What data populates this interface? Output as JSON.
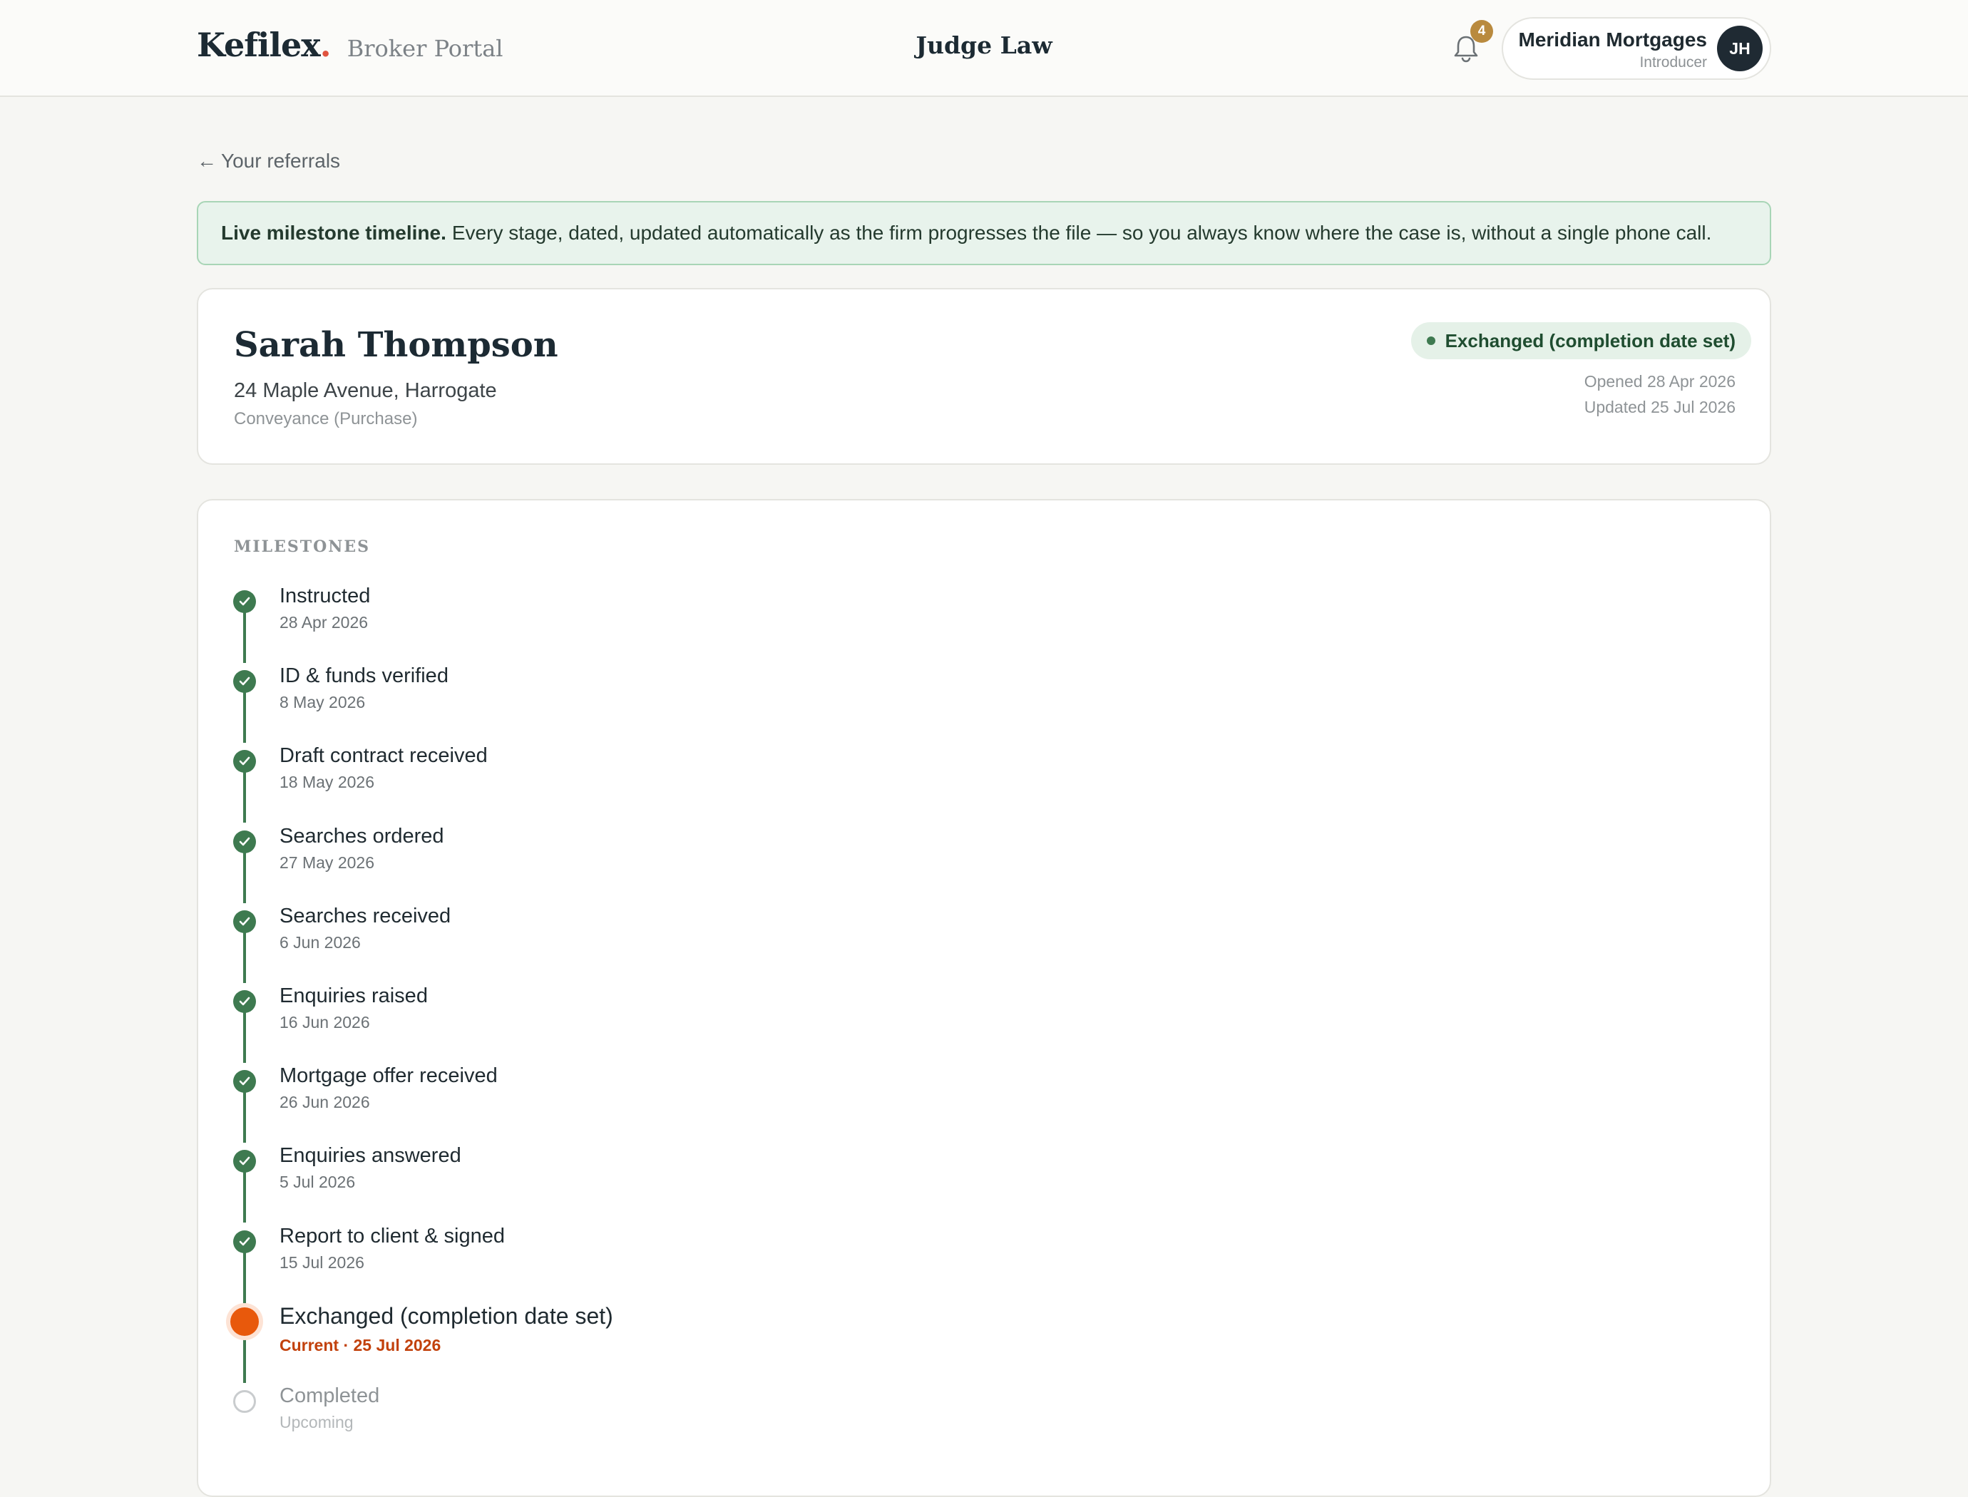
{
  "header": {
    "brand": "Kefilex",
    "brand_dot": ".",
    "portal": "Broker Portal",
    "firm": "Judge Law",
    "notification_count": "4",
    "account_name": "Meridian Mortgages",
    "account_role": "Introducer",
    "avatar_initials": "JH"
  },
  "nav": {
    "back_arrow": "←",
    "back_label": "Your referrals"
  },
  "banner": {
    "bold": "Live milestone timeline.",
    "text": "Every stage, dated, updated automatically as the firm progresses the file — so you always know where the case is, without a single phone call."
  },
  "case": {
    "client_name": "Sarah Thompson",
    "address": "24 Maple Avenue, Harrogate",
    "type": "Conveyance (Purchase)",
    "status": "Exchanged (completion date set)",
    "opened": "Opened 28 Apr 2026",
    "updated": "Updated 25 Jul 2026"
  },
  "milestones": {
    "heading": "MILESTONES",
    "items": [
      {
        "title": "Instructed",
        "date": "28 Apr 2026",
        "state": "done"
      },
      {
        "title": "ID & funds verified",
        "date": "8 May 2026",
        "state": "done"
      },
      {
        "title": "Draft contract received",
        "date": "18 May 2026",
        "state": "done"
      },
      {
        "title": "Searches ordered",
        "date": "27 May 2026",
        "state": "done"
      },
      {
        "title": "Searches received",
        "date": "6 Jun 2026",
        "state": "done"
      },
      {
        "title": "Enquiries raised",
        "date": "16 Jun 2026",
        "state": "done"
      },
      {
        "title": "Mortgage offer received",
        "date": "26 Jun 2026",
        "state": "done"
      },
      {
        "title": "Enquiries answered",
        "date": "5 Jul 2026",
        "state": "done"
      },
      {
        "title": "Report to client & signed",
        "date": "15 Jul 2026",
        "state": "done"
      },
      {
        "title": "Exchanged (completion date set)",
        "date": "Current · 25 Jul 2026",
        "state": "current"
      },
      {
        "title": "Completed",
        "date": "Upcoming",
        "state": "upcoming"
      }
    ]
  },
  "colors": {
    "accent_green": "#3e7a50",
    "current_orange": "#e8590c",
    "brand_dot": "#e0533f",
    "badge": "#b98a3e"
  }
}
